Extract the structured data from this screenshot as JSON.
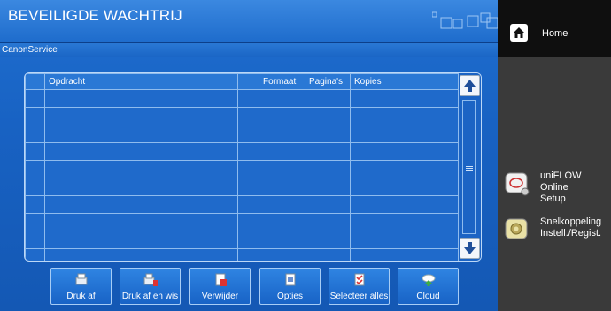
{
  "header": {
    "title": "BEVEILIGDE WACHTRIJ",
    "subtitle": "CanonService"
  },
  "table": {
    "columns": [
      "Opdracht",
      "Formaat",
      "Pagina's",
      "Kopies"
    ],
    "rows": 10
  },
  "toolbar": {
    "buttons": [
      {
        "label": "Druk af",
        "icon": "print-icon"
      },
      {
        "label": "Druk af en wis",
        "icon": "print-delete-icon"
      },
      {
        "label": "Verwijder",
        "icon": "delete-icon"
      },
      {
        "label": "Opties",
        "icon": "options-icon"
      },
      {
        "label": "Selecteer alles",
        "icon": "select-all-icon"
      },
      {
        "label": "Cloud",
        "icon": "cloud-icon"
      }
    ]
  },
  "sidebar": {
    "home_label": "Home",
    "items": [
      {
        "line1": "uniFLOW Online",
        "line2": "Setup",
        "icon": "uniflow-setup-icon"
      },
      {
        "line1": "Snelkoppeling",
        "line2": "Instell./Regist.",
        "icon": "settings-shortcut-icon"
      }
    ]
  },
  "colors": {
    "main_bg": "#1862c3",
    "grid_line": "#8fbcee",
    "side_bg": "#3a3a3a",
    "home_bg": "#0f0f0f"
  }
}
